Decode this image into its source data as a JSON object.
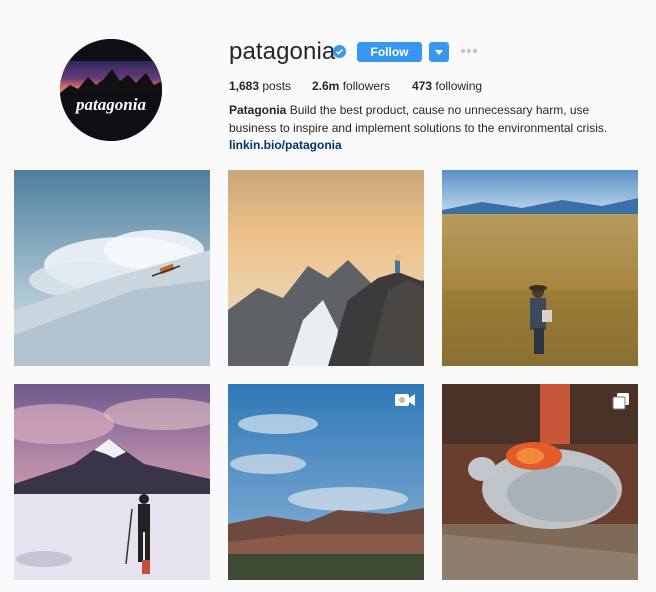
{
  "profile": {
    "username": "patagonia",
    "verified": true,
    "avatar_brand": "patagonia",
    "follow_label": "Follow",
    "icons": {
      "verified": "verified-badge-icon",
      "dropdown": "chevron-down-icon",
      "more": "more-dots-icon"
    },
    "accent_color": "#3897f0"
  },
  "stats": {
    "posts_count": "1,683",
    "posts_label": "posts",
    "followers_count": "2.6m",
    "followers_label": "followers",
    "following_count": "473",
    "following_label": "following"
  },
  "bio": {
    "name": "Patagonia",
    "text": "Build the best product, cause no unnecessary harm, use business to inspire and implement solutions to the environmental crisis.",
    "link": "linkin.bio/patagonia"
  },
  "posts": [
    {
      "subject": "skier in powder spray",
      "type": "photo"
    },
    {
      "subject": "person on rocky peak at sunset",
      "type": "photo"
    },
    {
      "subject": "hiker in golden grassland",
      "type": "photo"
    },
    {
      "subject": "backcountry skier under volcano",
      "type": "photo"
    },
    {
      "subject": "mesa landscape under blue sky",
      "type": "video",
      "icon": "video-camera-icon"
    },
    {
      "subject": "sleeping bag on log",
      "type": "carousel",
      "icon": "multiple-photos-icon"
    }
  ]
}
